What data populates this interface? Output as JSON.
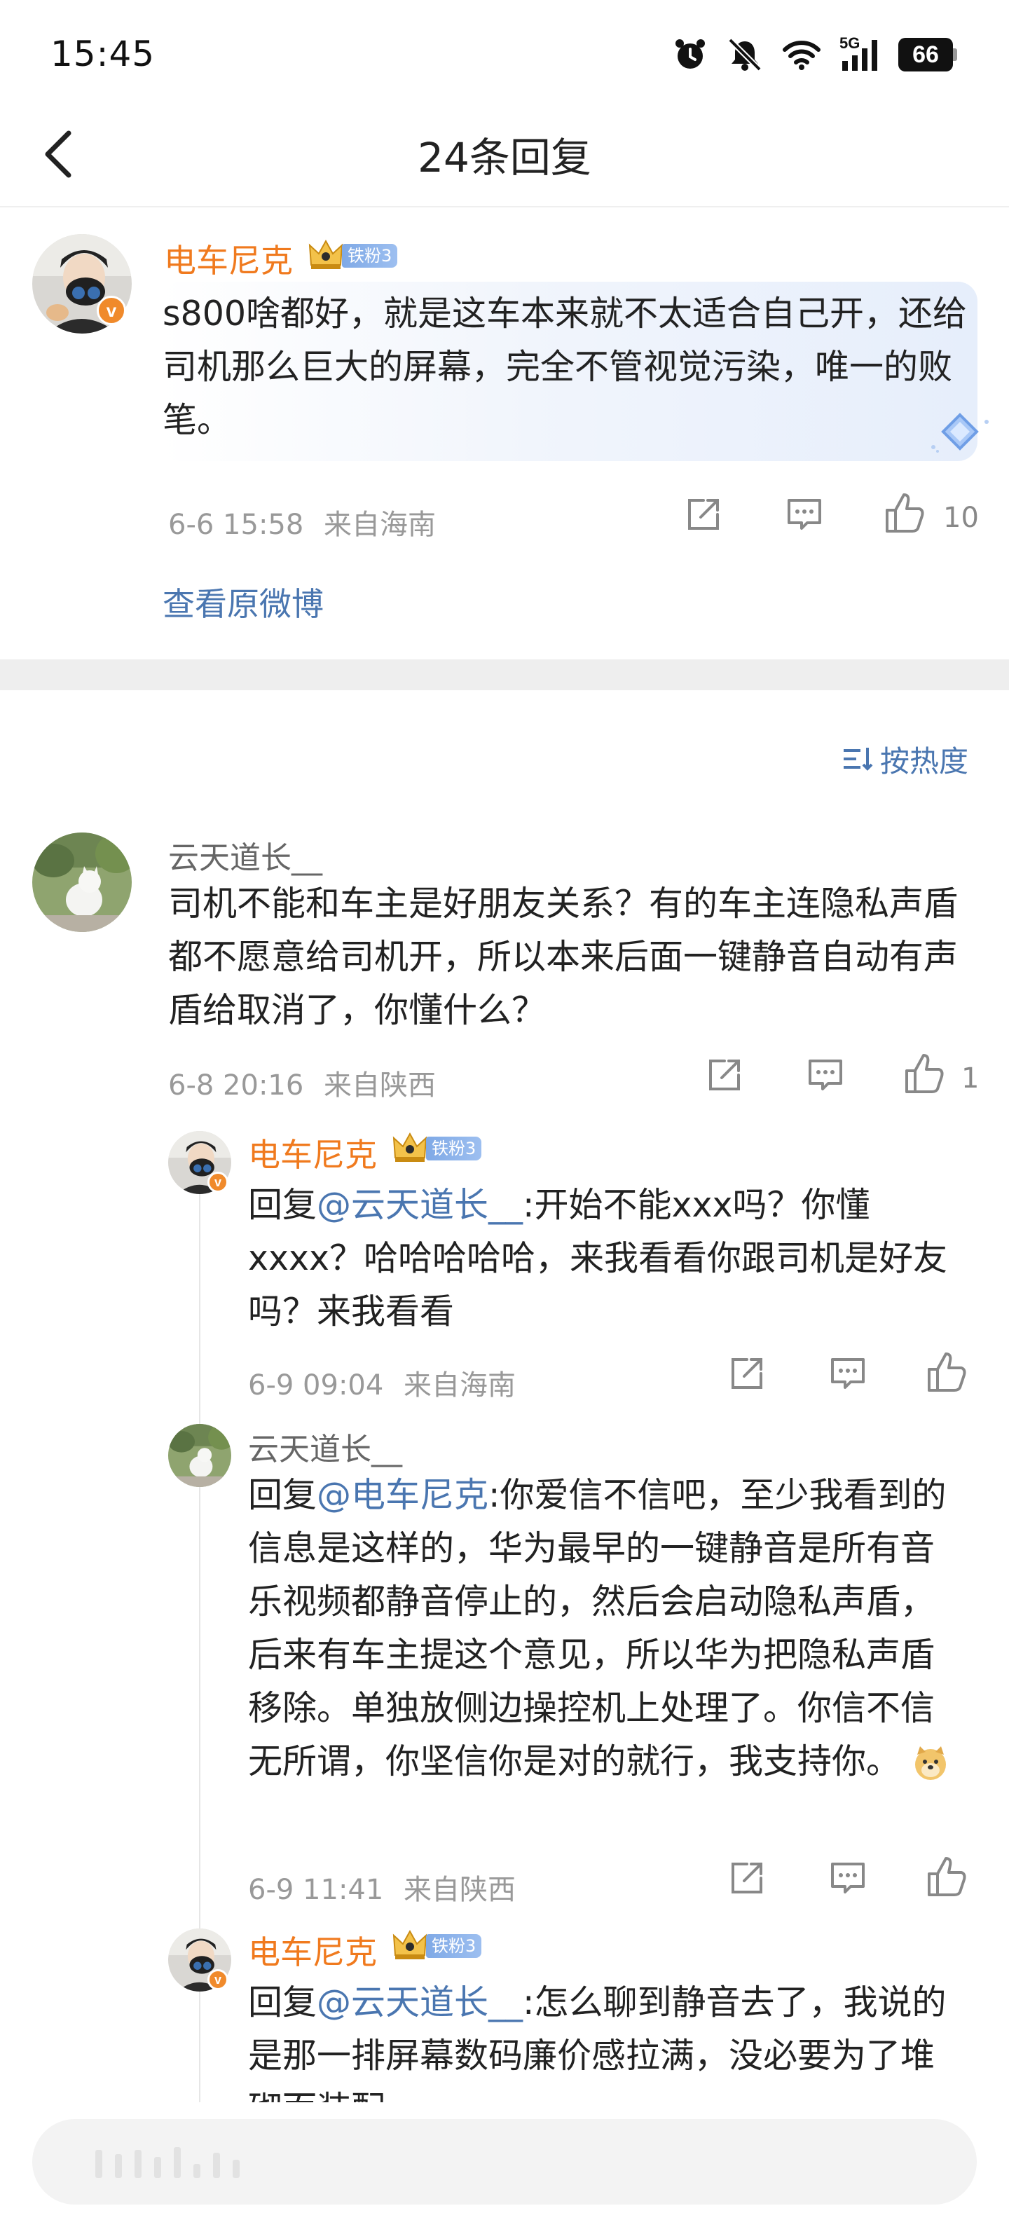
{
  "status_bar": {
    "time": "15:45",
    "network": "5G",
    "battery": "66",
    "icons": [
      "alarm-icon",
      "mute-icon",
      "wifi-icon",
      "signal-icon",
      "battery-icon"
    ]
  },
  "header": {
    "title": "24条回复",
    "back_icon": "back-arrow-icon"
  },
  "main_comment": {
    "author": "电车尼克",
    "fan_badge": "铁粉3",
    "text": "s800啥都好，就是这车本来就不太适合自己开，还给司机那么巨大的屏幕，完全不管视觉污染，唯一的败笔。",
    "time": "6-6 15:58",
    "location": "来自海南",
    "likes": "10",
    "view_original": "查看原微博"
  },
  "sort": {
    "label": "按热度",
    "icon": "sort-icon"
  },
  "replies": [
    {
      "author": "云天道长__",
      "text": "司机不能和车主是好朋友关系？有的车主连隐私声盾都不愿意给司机开，所以本来后面一键静音自动有声盾给取消了，你懂什么？",
      "time": "6-8 20:16",
      "location": "来自陕西",
      "likes": "1"
    },
    {
      "author": "电车尼克",
      "fan_badge": "铁粉3",
      "reply_prefix": "回复",
      "mention": "@云天道长__",
      "text": ":开始不能xxx吗？你懂xxxx？哈哈哈哈哈，来我看看你跟司机是好友吗？来我看看",
      "time": "6-9 09:04",
      "location": "来自海南"
    },
    {
      "author": "云天道长__",
      "reply_prefix": "回复",
      "mention": "@电车尼克",
      "text": ":你爱信不信吧，至少我看到的信息是这样的，华为最早的一键静音是所有音乐视频都静音停止的，然后会启动隐私声盾，后来有车主提这个意见，所以华为把隐私声盾移除。单独放侧边操控机上处理了。你信不信无所谓，你坚信你是对的就行，我支持你。",
      "emoji": "doge-emoji",
      "time": "6-9 11:41",
      "location": "来自陕西"
    },
    {
      "author": "电车尼克",
      "fan_badge": "铁粉3",
      "reply_prefix": "回复",
      "mention": "@云天道长__",
      "text": ":怎么聊到静音去了，我说的是那一排屏幕数码廉价感拉满，没必要为了堆砌而装配"
    }
  ],
  "colors": {
    "accent_blue": "#4a76b0",
    "name_orange": "#f07a1e",
    "meta_grey": "#999999",
    "divider": "#eeeeee"
  }
}
